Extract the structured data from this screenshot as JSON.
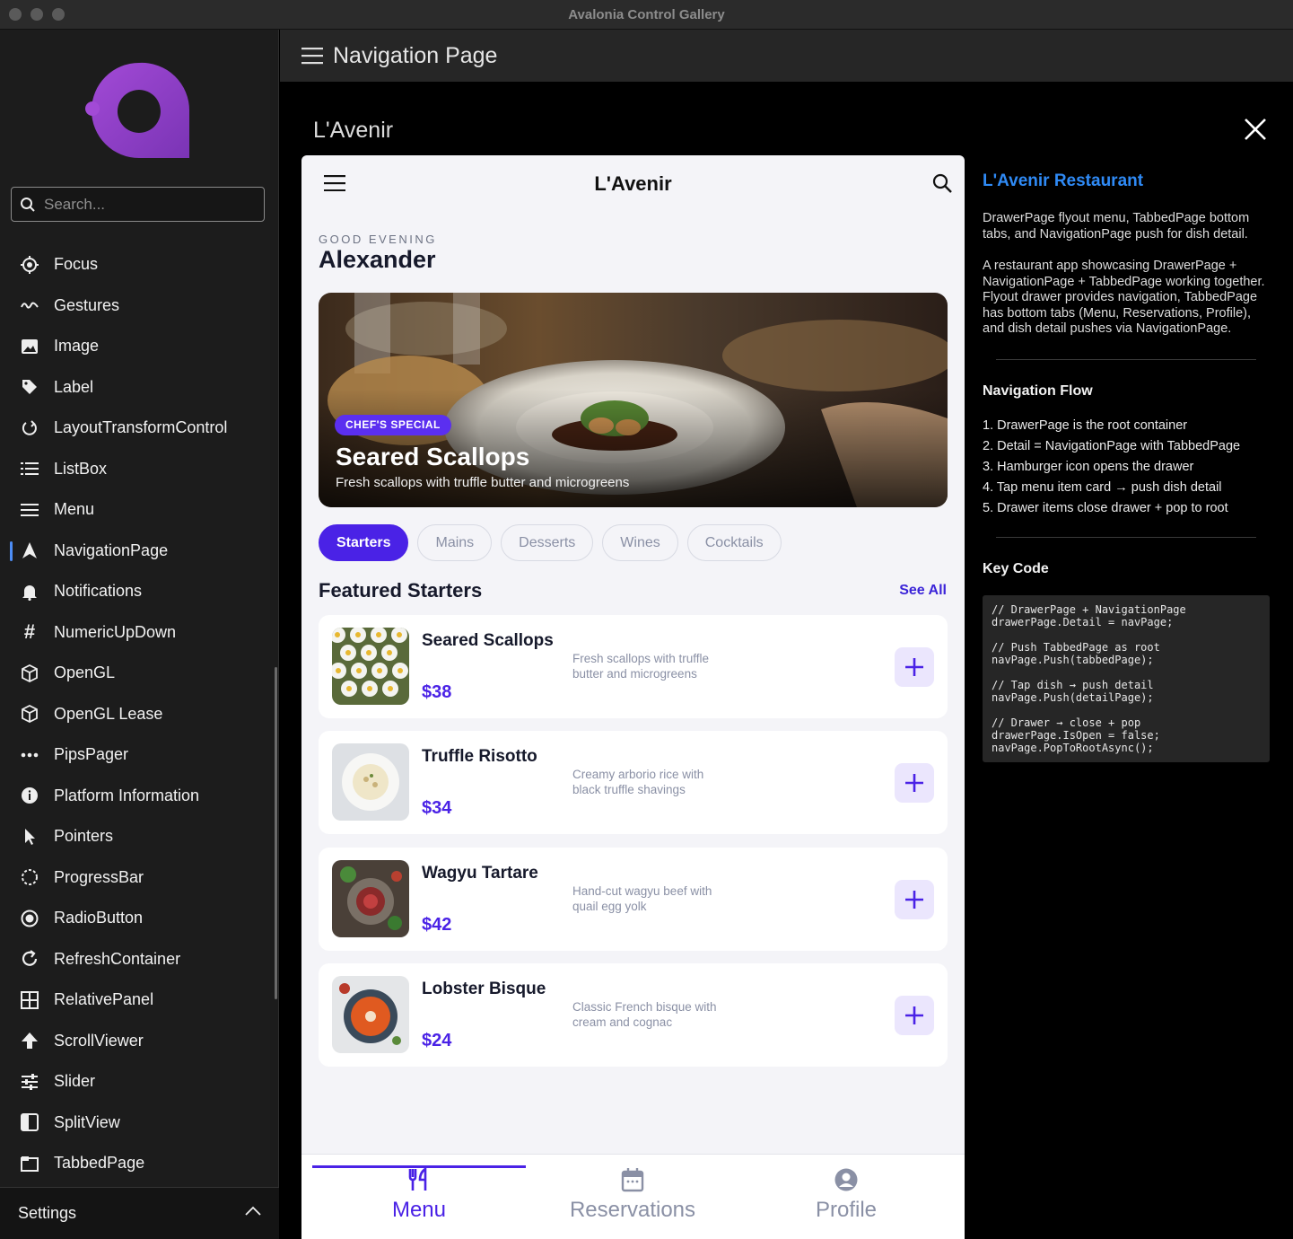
{
  "window": {
    "title": "Avalonia Control Gallery"
  },
  "sidebar": {
    "search_placeholder": "Search...",
    "items": [
      {
        "label": "Focus",
        "icon": "focus-icon"
      },
      {
        "label": "Gestures",
        "icon": "gestures-icon"
      },
      {
        "label": "Image",
        "icon": "image-icon"
      },
      {
        "label": "Label",
        "icon": "label-tag-icon"
      },
      {
        "label": "LayoutTransformControl",
        "icon": "rotate-icon"
      },
      {
        "label": "ListBox",
        "icon": "list-icon"
      },
      {
        "label": "Menu",
        "icon": "menu-icon"
      },
      {
        "label": "NavigationPage",
        "icon": "navigation-icon",
        "active": true
      },
      {
        "label": "Notifications",
        "icon": "bell-icon"
      },
      {
        "label": "NumericUpDown",
        "icon": "hash-icon"
      },
      {
        "label": "OpenGL",
        "icon": "cube-icon"
      },
      {
        "label": "OpenGL Lease",
        "icon": "cube-icon"
      },
      {
        "label": "PipsPager",
        "icon": "dots-icon"
      },
      {
        "label": "Platform Information",
        "icon": "info-icon"
      },
      {
        "label": "Pointers",
        "icon": "cursor-icon"
      },
      {
        "label": "ProgressBar",
        "icon": "progress-ring-icon"
      },
      {
        "label": "RadioButton",
        "icon": "radio-icon"
      },
      {
        "label": "RefreshContainer",
        "icon": "refresh-icon"
      },
      {
        "label": "RelativePanel",
        "icon": "grid-icon"
      },
      {
        "label": "ScrollViewer",
        "icon": "arrow-up-icon"
      },
      {
        "label": "Slider",
        "icon": "slider-icon"
      },
      {
        "label": "SplitView",
        "icon": "splitview-icon"
      },
      {
        "label": "TabbedPage",
        "icon": "tab-icon"
      }
    ],
    "settings_label": "Settings"
  },
  "header": {
    "title": "Navigation Page"
  },
  "page": {
    "title": "L'Avenir"
  },
  "phone": {
    "title": "L'Avenir",
    "greeting": "GOOD EVENING",
    "user_name": "Alexander",
    "hero": {
      "badge": "CHEF'S SPECIAL",
      "title": "Seared Scallops",
      "subtitle": "Fresh scallops with truffle butter and microgreens"
    },
    "tabs": [
      "Starters",
      "Mains",
      "Desserts",
      "Wines",
      "Cocktails"
    ],
    "section_title": "Featured Starters",
    "see_all": "See All",
    "dishes": [
      {
        "name": "Seared Scallops",
        "description": "Fresh scallops with truffle butter and microgreens",
        "price": "$38"
      },
      {
        "name": "Truffle Risotto",
        "description": "Creamy arborio rice with black truffle shavings",
        "price": "$34"
      },
      {
        "name": "Wagyu Tartare",
        "description": "Hand-cut wagyu beef with quail egg yolk",
        "price": "$42"
      },
      {
        "name": "Lobster Bisque",
        "description": "Classic French bisque with cream and cognac",
        "price": "$24"
      }
    ],
    "bottom_tabs": [
      {
        "label": "Menu",
        "icon": "utensils-icon",
        "active": true
      },
      {
        "label": "Reservations",
        "icon": "calendar-icon"
      },
      {
        "label": "Profile",
        "icon": "person-icon"
      }
    ]
  },
  "info": {
    "title": "L'Avenir Restaurant",
    "intro": "DrawerPage flyout menu, TabbedPage bottom tabs, and NavigationPage push for dish detail.",
    "description": "A restaurant app showcasing DrawerPage + NavigationPage + TabbedPage working together. Flyout drawer provides navigation, TabbedPage has bottom tabs (Menu, Reservations, Profile), and dish detail pushes via NavigationPage.",
    "flow_title": "Navigation Flow",
    "flow": [
      "1. DrawerPage is the root container",
      "2. Detail = NavigationPage with TabbedPage",
      "3. Hamburger icon opens the drawer",
      "4. Tap menu item card → push dish detail",
      "5. Drawer items close drawer + pop to root"
    ],
    "code_title": "Key Code",
    "code": "// DrawerPage + NavigationPage\ndrawerPage.Detail = navPage;\n\n// Push TabbedPage as root\nnavPage.Push(tabbedPage);\n\n// Tap dish → push detail\nnavPage.Push(detailPage);\n\n// Drawer → close + pop\ndrawerPage.IsOpen = false;\nnavPage.PopToRootAsync();"
  },
  "colors": {
    "accent": "#4a22e6",
    "link": "#2f8af5",
    "logo": "#8e3fc2"
  }
}
